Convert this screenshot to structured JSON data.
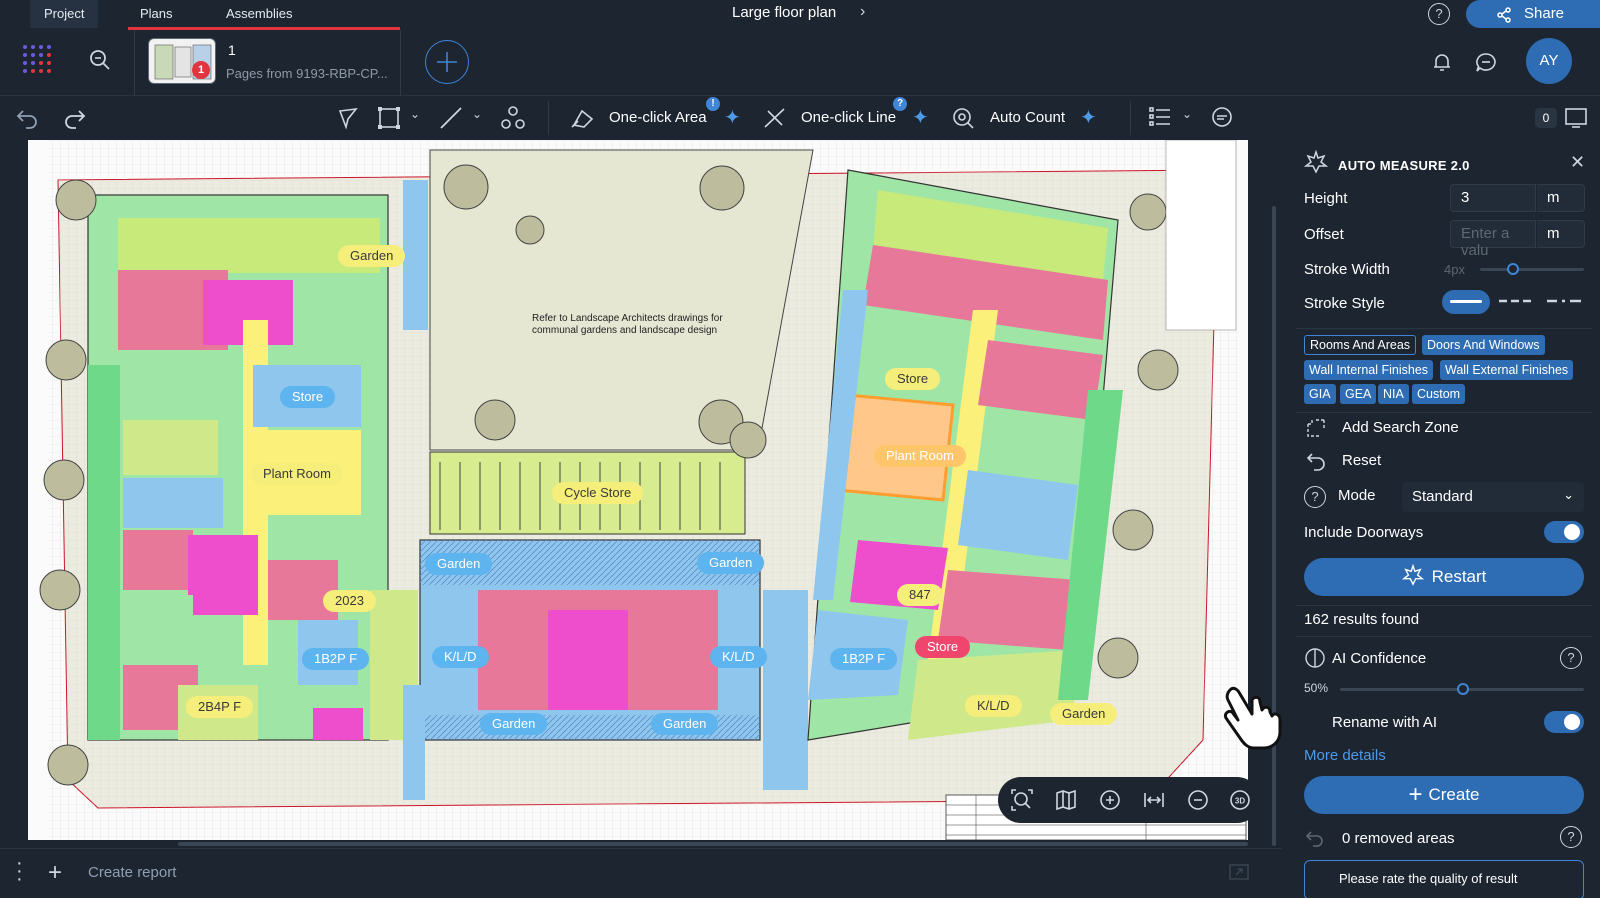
{
  "topbar": {
    "tabs": [
      {
        "label": "Project"
      },
      {
        "label": "Plans"
      },
      {
        "label": "Assemblies"
      }
    ],
    "document_title": "Large floor plan",
    "share_label": "Share"
  },
  "plan": {
    "number": "1",
    "subtitle": "Pages from 9193-RBP-CP...",
    "badge_count": "1"
  },
  "user": {
    "initials": "AY"
  },
  "toolbar": {
    "one_click_area": "One-click Area",
    "one_click_area_badge": "!",
    "one_click_line": "One-click Line",
    "one_click_line_badge": "?",
    "auto_count": "Auto Count",
    "layer_count": "0"
  },
  "canvas": {
    "note": "Refer to Landscape Architects drawings for communal gardens and landscape design",
    "labels": {
      "garden_tl": "Garden",
      "store_l": "Store",
      "plant_room_l": "Plant Room",
      "cycle_store": "Cycle Store",
      "garden_cl": "Garden",
      "garden_cr": "Garden",
      "n2023": "2023",
      "b1": "1B2P F",
      "b2": "2B4P F",
      "klkd_l": "K/L/D",
      "klkd_r": "K/L/D",
      "garden_bl": "Garden",
      "garden_br": "Garden",
      "store_r": "Store",
      "plant_room_r": "Plant Room",
      "n847": "847",
      "b3": "1B2P F",
      "store_red": "Store",
      "klkd_rr": "K/L/D",
      "garden_rr": "Garden"
    }
  },
  "panel": {
    "title": "AUTO MEASURE 2.0",
    "height_label": "Height",
    "height_value": "3",
    "height_unit": "m",
    "offset_label": "Offset",
    "offset_placeholder": "Enter a valu",
    "offset_unit": "m",
    "stroke_width_label": "Stroke Width",
    "stroke_width_value": "4px",
    "stroke_style_label": "Stroke Style",
    "chips": [
      "Rooms And Areas",
      "Doors And Windows",
      "Wall Internal Finishes",
      "Wall External Finishes",
      "GIA",
      "GEA",
      "NIA",
      "Custom"
    ],
    "add_search_zone": "Add Search Zone",
    "reset": "Reset",
    "mode_label": "Mode",
    "mode_value": "Standard",
    "include_doorways": "Include Doorways",
    "restart": "Restart",
    "results": "162 results found",
    "ai_confidence": "AI Confidence",
    "ai_confidence_value": "50%",
    "rename_with_ai": "Rename with AI",
    "more_details": "More details",
    "create": "Create",
    "removed_areas": "0 removed areas",
    "feedback": "Please rate the quality of result"
  },
  "bottombar": {
    "create_report": "Create report"
  },
  "colors": {
    "accent": "#2e6db3",
    "alert": "#e0353f",
    "bg": "#1c2530"
  }
}
